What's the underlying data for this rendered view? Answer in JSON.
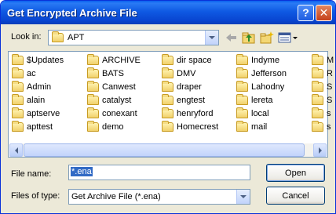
{
  "window": {
    "title": "Get Encrypted Archive File",
    "help_label": "?",
    "close_label": "✕"
  },
  "look_in": {
    "label": "Look in:",
    "value": "APT"
  },
  "toolbar": {
    "back_icon": "back-arrow-icon",
    "up_icon": "up-one-level-icon",
    "new_folder_icon": "new-folder-icon",
    "views_icon": "views-menu-icon"
  },
  "folders": {
    "col1": [
      "$Updates",
      "ac",
      "Admin",
      "alain",
      "aptserve",
      "apttest"
    ],
    "col2": [
      "ARCHIVE",
      "BATS",
      "Canwest",
      "catalyst",
      "conexant",
      "demo"
    ],
    "col3": [
      "dir space",
      "DMV",
      "draper",
      "engtest",
      "henryford",
      "Homecrest"
    ],
    "col4": [
      "Indyme",
      "Jefferson",
      "Lahodny",
      "lereta",
      "local",
      "mail"
    ],
    "col5": [
      "M",
      "R",
      "S",
      "S",
      "s",
      "s"
    ]
  },
  "file_name": {
    "label": "File name:",
    "value": "*.ena"
  },
  "file_type": {
    "label": "Files of type:",
    "value": "Get Archive File (*.ena)"
  },
  "buttons": {
    "open": "Open",
    "cancel": "Cancel"
  }
}
